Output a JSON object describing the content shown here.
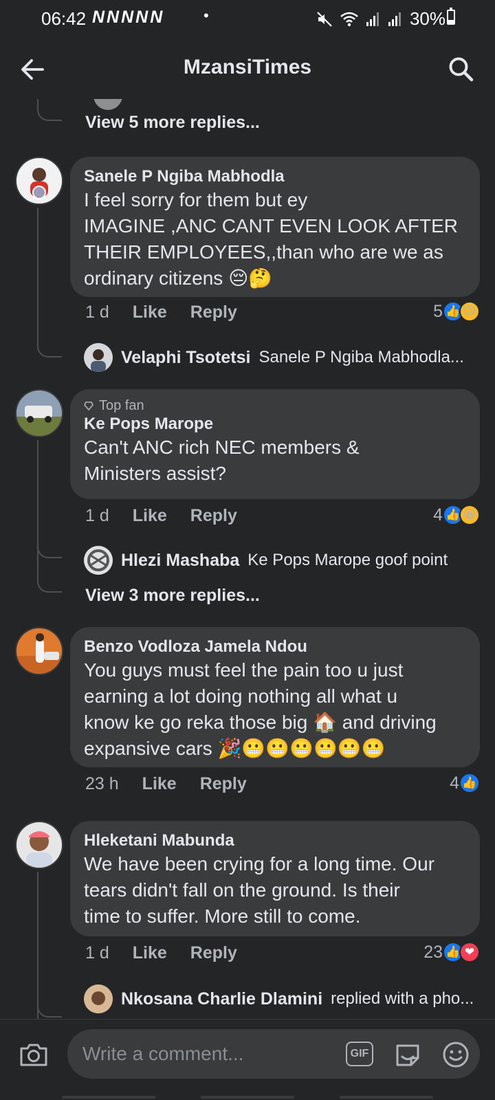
{
  "status_bar": {
    "time": "06:42",
    "network_icons": "NNNNN",
    "dot": "•",
    "battery": "30%"
  },
  "header": {
    "title": "MzansiTimes"
  },
  "feed": {
    "view_more_top": "View 5 more replies...",
    "comments": [
      {
        "author": "Sanele P Ngiba Mabhodla",
        "lines": [
          "I feel sorry for them but ey",
          "IMAGINE ,ANC CANT EVEN LOOK AFTER",
          "THEIR EMPLOYEES,,than who are we as",
          "ordinary citizens 😔🤔"
        ],
        "time": "1 d",
        "like": "Like",
        "reply": "Reply",
        "reaction_count": "5",
        "reactions": [
          "👍",
          "😥"
        ],
        "replies": [
          {
            "name": "Velaphi Tsotetsi",
            "text": "Sanele P Ngiba Mabhodla..."
          }
        ]
      },
      {
        "badge": "Top fan",
        "author": "Ke Pops Marope",
        "lines": [
          "Can't ANC rich NEC members &",
          "Ministers assist?"
        ],
        "time": "1 d",
        "like": "Like",
        "reply": "Reply",
        "reaction_count": "4",
        "reactions": [
          "👍",
          "😆"
        ],
        "replies": [
          {
            "name": "Hlezi Mashaba",
            "text": "Ke Pops Marope goof point"
          }
        ],
        "view_more": "View 3 more replies..."
      },
      {
        "author": "Benzo Vodloza Jamela Ndou",
        "lines": [
          "You guys must feel the pain too u just",
          "earning a lot doing nothing all what u",
          "know ke go reka those big 🏠 and driving",
          "expansive cars 🎉😬😬😬😬😬😬"
        ],
        "time": "23 h",
        "like": "Like",
        "reply": "Reply",
        "reaction_count": "4",
        "reactions": [
          "👍"
        ]
      },
      {
        "author": "Hleketani Mabunda",
        "lines": [
          "We have been crying for a long time. Our",
          "tears didn't fall on the ground. Is their",
          "time to suffer. More still to come."
        ],
        "time": "1 d",
        "like": "Like",
        "reply": "Reply",
        "reaction_count": "23",
        "reactions": [
          "👍",
          "❤"
        ],
        "replies": [
          {
            "name": "Nkosana Charlie Dlamini",
            "text": "replied with a pho..."
          }
        ]
      }
    ]
  },
  "composer": {
    "placeholder": "Write a comment...",
    "gif_label": "GIF"
  },
  "colors": {
    "background": "#242526",
    "bubble": "#3a3b3c",
    "primary_text": "#e4e6eb",
    "secondary_text": "#b0b3b8",
    "like_blue": "#1877f2",
    "love_red": "#f33e58"
  },
  "icons": [
    "back-arrow-icon",
    "search-icon",
    "camera-icon",
    "gif-icon",
    "sticker-icon",
    "emoji-icon",
    "mute-icon",
    "wifi-icon",
    "signal-icon",
    "battery-icon",
    "top-fan-badge-icon"
  ]
}
